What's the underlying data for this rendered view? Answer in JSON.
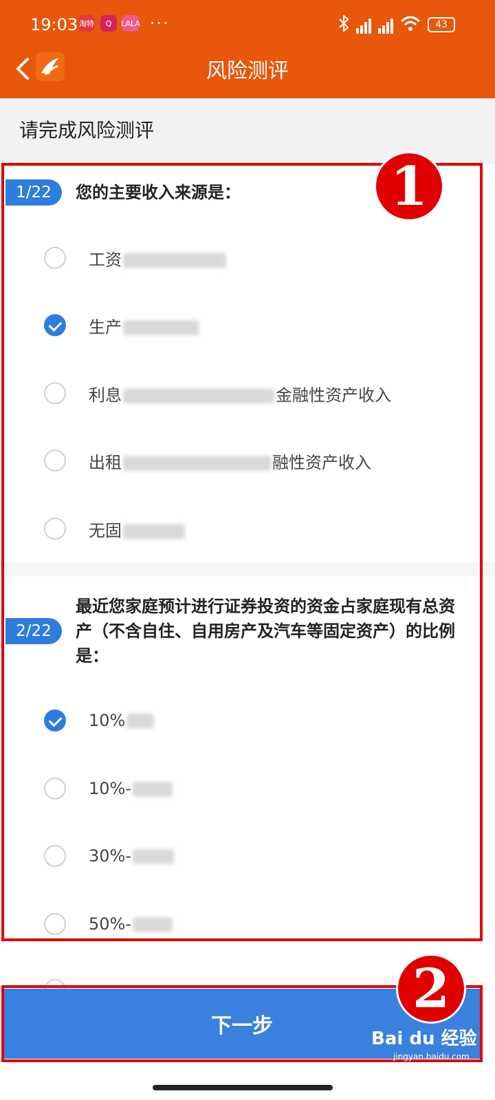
{
  "status": {
    "time": "19:03",
    "apps": [
      "淘特",
      "Q",
      "LALA"
    ],
    "overflow": "···",
    "battery": "43"
  },
  "header": {
    "title": "风险测评",
    "back_icon": "chevron-left-icon"
  },
  "subheader": "请完成风险测评",
  "questions": [
    {
      "index": "1/22",
      "text": "您的主要收入来源是：",
      "options": [
        {
          "prefix": "工资",
          "suffix": "",
          "checked": false
        },
        {
          "prefix": "生产",
          "suffix": "",
          "checked": true
        },
        {
          "prefix": "利息",
          "suffix": "金融性资产收入",
          "checked": false
        },
        {
          "prefix": "出租",
          "suffix": "融性资产收入",
          "checked": false
        },
        {
          "prefix": "无固",
          "suffix": "",
          "checked": false
        }
      ]
    },
    {
      "index": "2/22",
      "text": "最近您家庭预计进行证券投资的资金占家庭现有总资产（不含自住、自用房产及汽车等固定资产）的比例是：",
      "options": [
        {
          "prefix": "10%",
          "suffix": "",
          "checked": true
        },
        {
          "prefix": "10%-",
          "suffix": "",
          "checked": false
        },
        {
          "prefix": "30%-",
          "suffix": "",
          "checked": false
        },
        {
          "prefix": "50%-",
          "suffix": "",
          "checked": false
        }
      ]
    }
  ],
  "annotations": {
    "marker1": "1",
    "marker2": "2"
  },
  "next_button": "下一步",
  "watermark": {
    "main": "Bai du 经验",
    "sub": "jingyan.baidu.com"
  }
}
